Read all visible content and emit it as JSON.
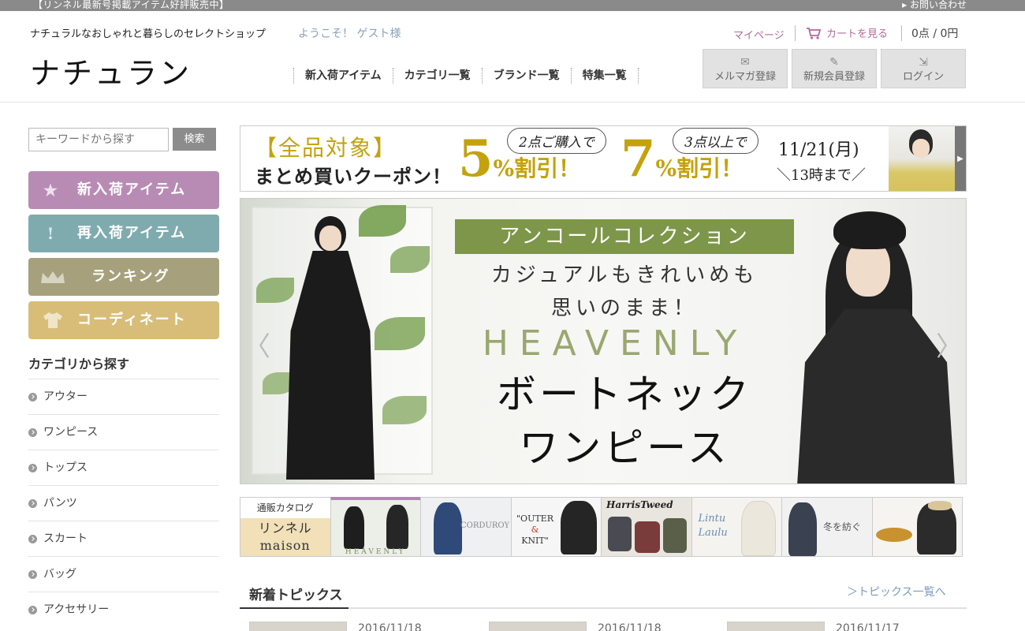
{
  "topbar": {
    "notice": "【リンネル最新号掲載アイテム好評販売中】",
    "contact": "お問い合わせ",
    "contact_icon": "triangle-right"
  },
  "header": {
    "tagline": "ナチュラルなおしゃれと暮らしのセレクトショップ",
    "logo": "ナチュラン",
    "welcome": "ようこそ！ ゲスト様",
    "mypage": "マイページ",
    "cart_label": "カートを見る",
    "cart_count": "0点 / 0円",
    "nav": [
      {
        "label": "新入荷アイテム"
      },
      {
        "label": "カテゴリ一覧"
      },
      {
        "label": "ブランド一覧"
      },
      {
        "label": "特集一覧"
      }
    ],
    "buttons": [
      {
        "label": "メルマガ登録",
        "icon": "envelope"
      },
      {
        "label": "新規会員登録",
        "icon": "pencil"
      },
      {
        "label": "ログイン",
        "icon": "login-door"
      }
    ]
  },
  "sidebar": {
    "search_placeholder": "キーワードから探す",
    "search_button": "検索",
    "feature_buttons": [
      {
        "label": "新入荷アイテム",
        "icon": "star",
        "color": "#b88bb4"
      },
      {
        "label": "再入荷アイテム",
        "icon": "exclamation",
        "color": "#7fabaf"
      },
      {
        "label": "ランキング",
        "icon": "crown",
        "color": "#a6a17c"
      },
      {
        "label": "コーディネート",
        "icon": "tshirt",
        "color": "#d8bd79"
      }
    ],
    "category_heading": "カテゴリから探す",
    "categories": [
      "アウター",
      "ワンピース",
      "トップス",
      "パンツ",
      "スカート",
      "バッグ",
      "アクセサリー"
    ]
  },
  "coupon": {
    "title": "【全品対象】",
    "subtitle": "まとめ買いクーポン！",
    "offer1_bubble": "2点ご購入で",
    "offer1_pct": "5",
    "offer2_bubble": "3点以上で",
    "offer2_pct": "7",
    "pct_suffix": "%割引！",
    "date": "11/21(月)",
    "until": "＼13時まで／"
  },
  "hero": {
    "label": "アンコールコレクション",
    "line1": "カジュアルもきれいめも",
    "line2": "思いのまま！",
    "brand": "HEAVENLY",
    "line3": "ボートネック",
    "line4": "ワンピース",
    "prev": "〈",
    "next": "〉"
  },
  "thumbnails": {
    "catalog_top": "通販カタログ",
    "catalog_name_1": "リンネル",
    "catalog_name_2": "maison",
    "items": [
      {
        "caption": "HEAVENLY"
      },
      {
        "caption": "CORDUROY"
      },
      {
        "caption_1": "\"OUTER",
        "caption_2": "&",
        "caption_3": "KNIT\""
      },
      {
        "caption": "HarrisTweed"
      },
      {
        "caption_1": "Lintu",
        "caption_2": "Laulu"
      },
      {
        "caption": "冬を紡ぐ"
      },
      {
        "caption": ""
      }
    ]
  },
  "topics": {
    "title": "新着トピックス",
    "more": "＞トピックス一覧へ",
    "items": [
      {
        "date": "2016/11/18"
      },
      {
        "date": "2016/11/18"
      },
      {
        "date": "2016/11/17"
      }
    ]
  }
}
